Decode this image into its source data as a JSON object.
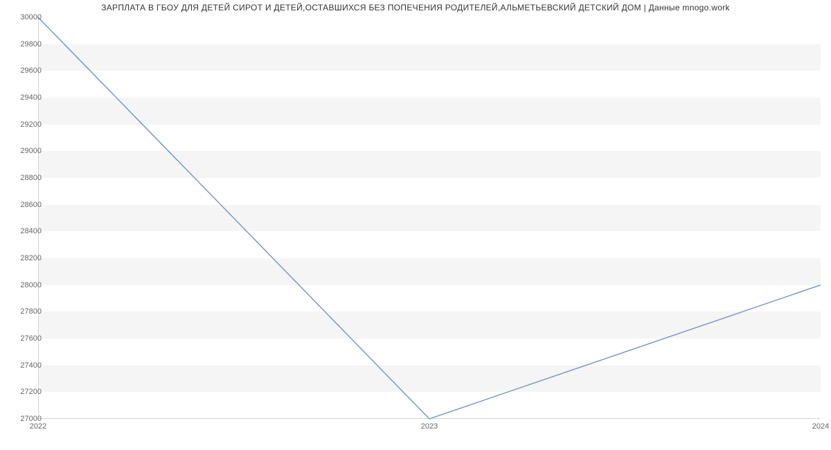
{
  "chart_data": {
    "type": "line",
    "title": "ЗАРПЛАТА В ГБОУ ДЛЯ ДЕТЕЙ СИРОТ И ДЕТЕЙ,ОСТАВШИХСЯ БЕЗ ПОПЕЧЕНИЯ РОДИТЕЛЕЙ,АЛЬМЕТЬЕВСКИЙ ДЕТСКИЙ ДОМ | Данные mnogo.work",
    "xlabel": "",
    "ylabel": "",
    "x": [
      "2022",
      "2023",
      "2024"
    ],
    "values": [
      30000,
      27000,
      28000
    ],
    "ylim": [
      27000,
      30000
    ],
    "y_ticks": [
      27000,
      27200,
      27400,
      27600,
      27800,
      28000,
      28200,
      28400,
      28600,
      28800,
      29000,
      29200,
      29400,
      29600,
      29800,
      30000
    ],
    "x_ticks": [
      "2022",
      "2023",
      "2024"
    ],
    "line_color": "#6f94c9",
    "band_color": "#f5f5f5",
    "grid": true
  }
}
